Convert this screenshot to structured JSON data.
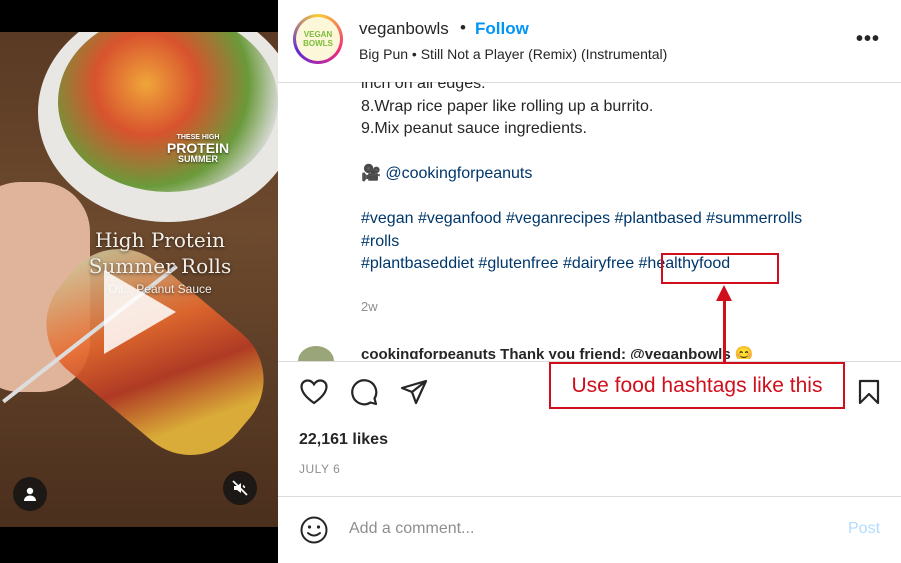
{
  "video": {
    "badge": [
      "THESE HIGH",
      "PROTEIN",
      "SUMMER"
    ],
    "title_line1": "High Protein",
    "title_line2": "Summer Rolls",
    "subtitle": "Oil... Peanut Sauce",
    "icons": {
      "play": "play-icon",
      "user": "user-icon",
      "mute": "mute-icon"
    }
  },
  "header": {
    "avatar_text": "VEGAN BOWLS",
    "username": "veganbowls",
    "separator": "•",
    "follow_label": "Follow",
    "music": "Big Pun • Still Not a Player (Remix) (Instrumental)",
    "more_label": "•••"
  },
  "caption": {
    "lines": [
      "inch on all edges.",
      "8.Wrap rice paper like rolling up a burrito.",
      "9.Mix peanut sauce ingredients."
    ],
    "mention_emoji": "🎥",
    "mention": "@cookingforpeanuts",
    "hashtags_line1": "#vegan #veganfood #veganrecipes #plantbased #summerrolls",
    "hashtags_line2": "#rolls",
    "hashtags_line3_a": "#plantbaseddiet #glutenfree #dairyfree ",
    "hashtags_line3_b": "#healthyfood",
    "time": "2w"
  },
  "comment_peek": "cookingforpeanuts Thank you friend: @veganbowls 😊",
  "actions": {
    "icons": [
      "heart-icon",
      "comment-icon",
      "share-icon",
      "bookmark-icon"
    ]
  },
  "likes": "22,161 likes",
  "date": "JULY 6",
  "add_comment": {
    "placeholder": "Add a comment...",
    "post_label": "Post"
  },
  "annotation": {
    "callout": "Use food hashtags like this",
    "color": "#d10f1c"
  },
  "colors": {
    "link": "#00376b",
    "follow": "#0095f6",
    "post_disabled": "#b3dbff"
  }
}
